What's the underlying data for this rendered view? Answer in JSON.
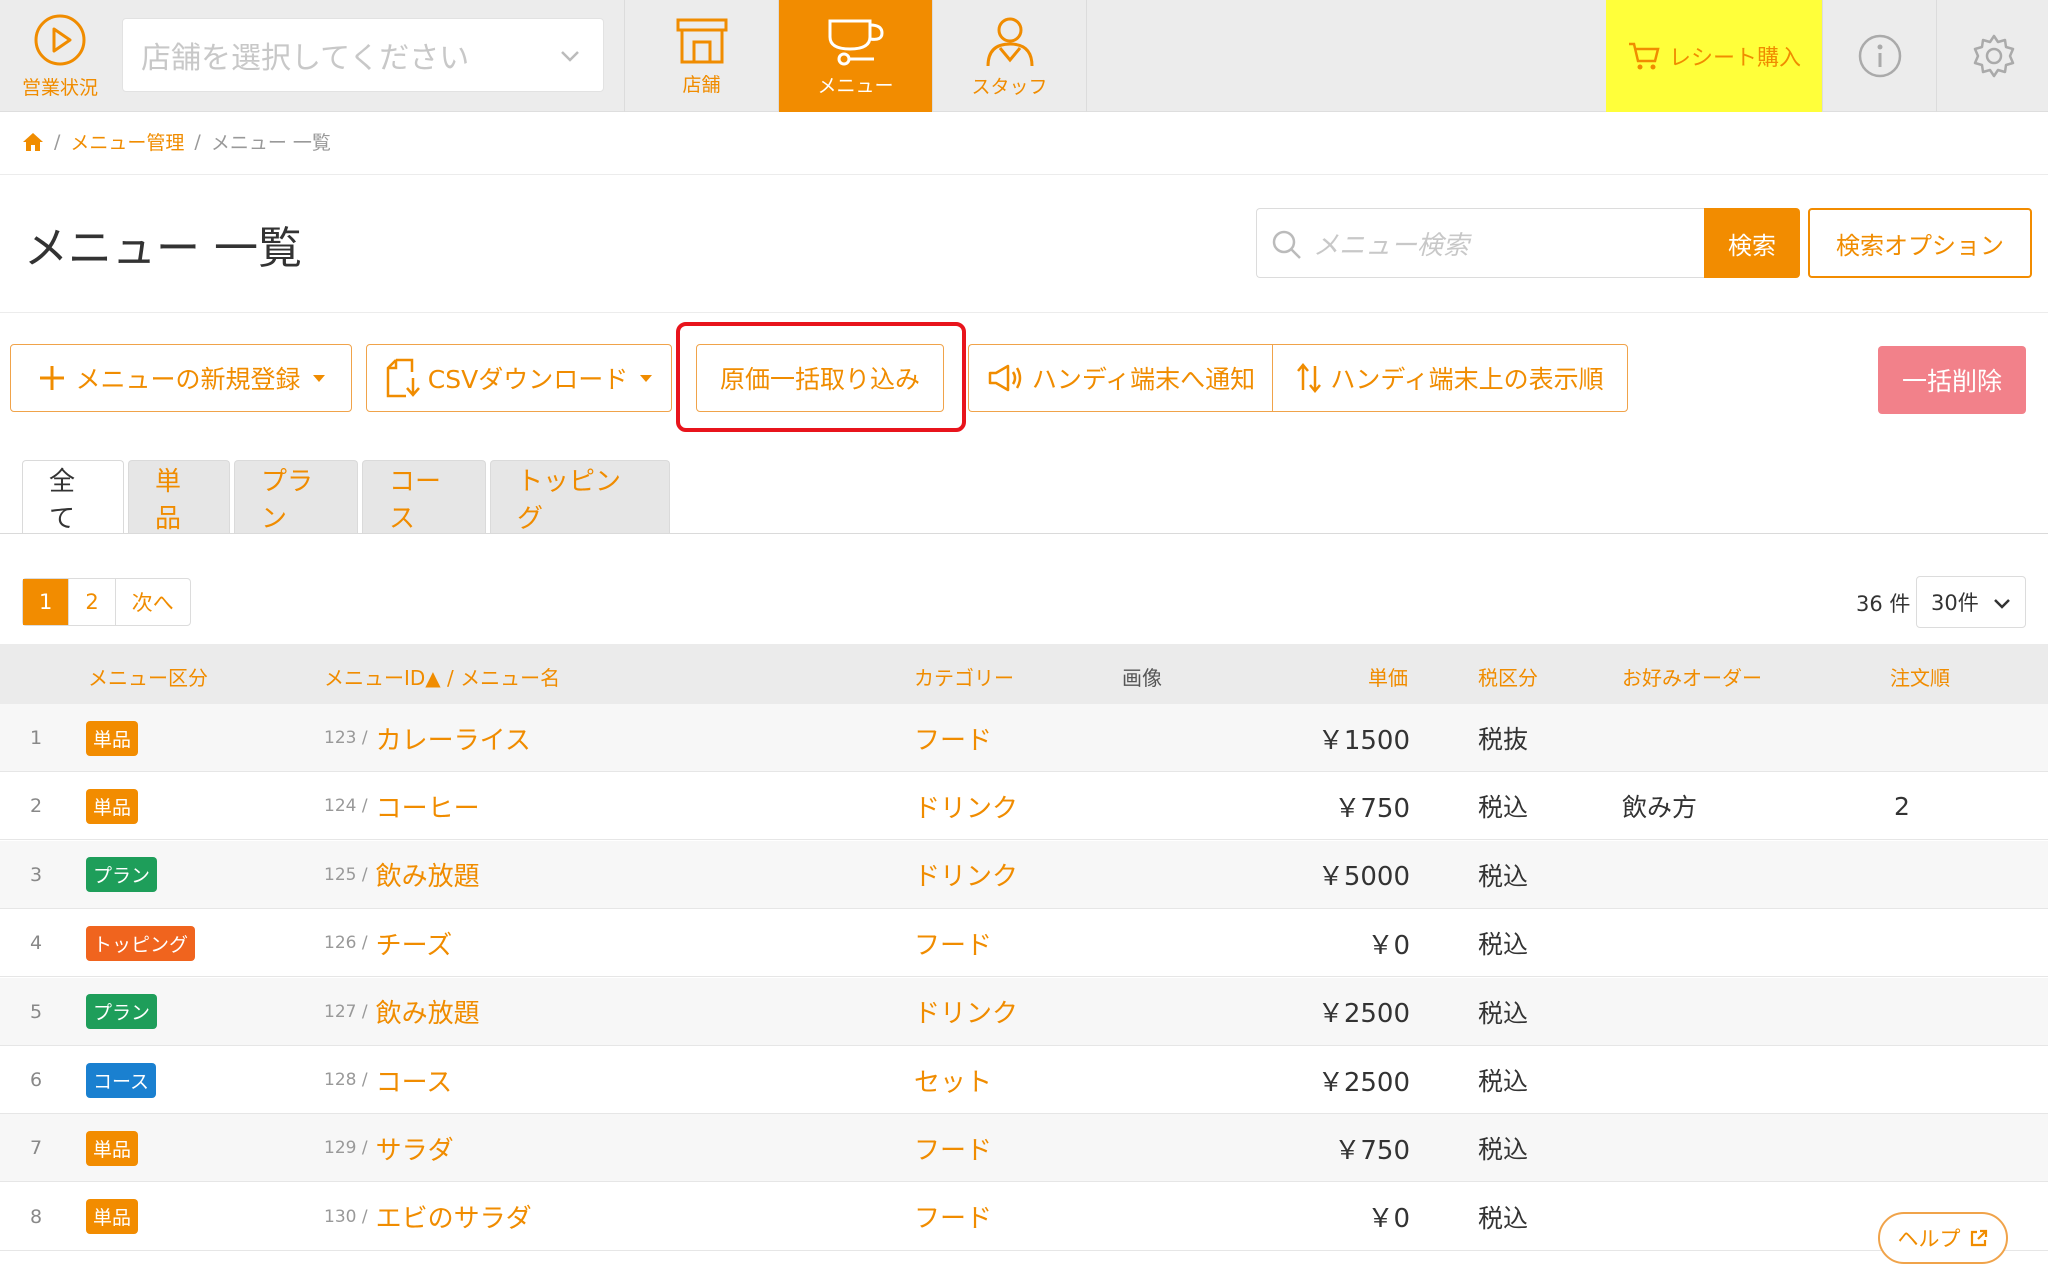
{
  "topbar": {
    "status_label": "営業状況",
    "store_placeholder": "店舗を選択してください",
    "tabs": [
      {
        "label": "店舗",
        "icon": "store-icon"
      },
      {
        "label": "メニュー",
        "icon": "menu-cup-icon"
      },
      {
        "label": "スタッフ",
        "icon": "staff-icon"
      }
    ],
    "receipt_label": "レシート購入"
  },
  "breadcrumb": {
    "home_icon": "home-icon",
    "items": [
      "メニュー管理",
      "メニュー 一覧"
    ]
  },
  "page": {
    "title": "メニュー 一覧",
    "search_placeholder": "メニュー検索",
    "search_button": "検索",
    "search_options": "検索オプション"
  },
  "actions": {
    "new_menu": "メニューの新規登録",
    "csv_download": "CSVダウンロード",
    "cost_import": "原価一括取り込み",
    "notify_handy": "ハンディ端末へ通知",
    "handy_order": "ハンディ端末上の表示順",
    "bulk_delete": "一括削除"
  },
  "tabs": [
    "全て",
    "単品",
    "プラン",
    "コース",
    "トッピング"
  ],
  "pagination": {
    "pages": [
      "1",
      "2"
    ],
    "next": "次へ",
    "total": "36 件",
    "per_page": "30件"
  },
  "table": {
    "headers": {
      "category_type": "メニュー区分",
      "id_name": "メニューID▲ / メニュー名",
      "category": "カテゴリー",
      "image": "画像",
      "price": "単価",
      "tax": "税区分",
      "preference": "お好みオーダー",
      "order": "注文順"
    },
    "rows": [
      {
        "no": "1",
        "type": "単品",
        "type_color": "#f28c00",
        "id": "123 /",
        "name": "カレーライス",
        "category": "フード",
        "price": "￥1500",
        "tax": "税抜",
        "pref": "",
        "order": ""
      },
      {
        "no": "2",
        "type": "単品",
        "type_color": "#f28c00",
        "id": "124 /",
        "name": "コーヒー",
        "category": "ドリンク",
        "price": "￥750",
        "tax": "税込",
        "pref": "飲み方",
        "order": "2"
      },
      {
        "no": "3",
        "type": "プラン",
        "type_color": "#1e9e5a",
        "id": "125 /",
        "name": "飲み放題",
        "category": "ドリンク",
        "price": "￥5000",
        "tax": "税込",
        "pref": "",
        "order": ""
      },
      {
        "no": "4",
        "type": "トッピング",
        "type_color": "#f0641e",
        "id": "126 /",
        "name": "チーズ",
        "category": "フード",
        "price": "￥0",
        "tax": "税込",
        "pref": "",
        "order": ""
      },
      {
        "no": "5",
        "type": "プラン",
        "type_color": "#1e9e5a",
        "id": "127 /",
        "name": "飲み放題",
        "category": "ドリンク",
        "price": "￥2500",
        "tax": "税込",
        "pref": "",
        "order": ""
      },
      {
        "no": "6",
        "type": "コース",
        "type_color": "#1a80d0",
        "id": "128 /",
        "name": "コース",
        "category": "セット",
        "price": "￥2500",
        "tax": "税込",
        "pref": "",
        "order": ""
      },
      {
        "no": "7",
        "type": "単品",
        "type_color": "#f28c00",
        "id": "129 /",
        "name": "サラダ",
        "category": "フード",
        "price": "￥750",
        "tax": "税込",
        "pref": "",
        "order": ""
      },
      {
        "no": "8",
        "type": "単品",
        "type_color": "#f28c00",
        "id": "130 /",
        "name": "エビのサラダ",
        "category": "フード",
        "price": "￥0",
        "tax": "税込",
        "pref": "",
        "order": ""
      }
    ]
  },
  "help_label": "ヘルプ"
}
